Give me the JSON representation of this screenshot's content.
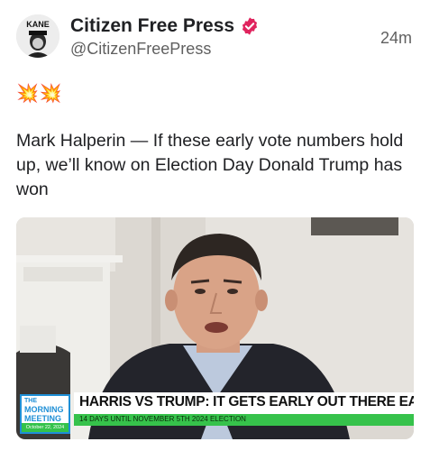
{
  "post": {
    "display_name": "Citizen Free Press",
    "handle": "@CitizenFreePress",
    "time": "24m",
    "emojis": "💥💥",
    "text": "Mark Halperin — If these early vote numbers hold up, we’ll know on Election Day Donald Trump has won"
  },
  "avatar": {
    "logo_text": "KANE"
  },
  "media": {
    "show_name_line1": "THE",
    "show_name_line2": "MORNING",
    "show_name_line3": "MEETING",
    "show_date": "October 22, 2024",
    "headline": "HARRIS VS TRUMP: IT GETS EARLY OUT THERE EARLY",
    "subheadline": "14 DAYS UNTIL NOVEMBER 5TH 2024 ELECTION"
  },
  "colors": {
    "verified": "#e0245e",
    "accent_green": "#36c24b",
    "logo_blue": "#1e8fd6"
  }
}
